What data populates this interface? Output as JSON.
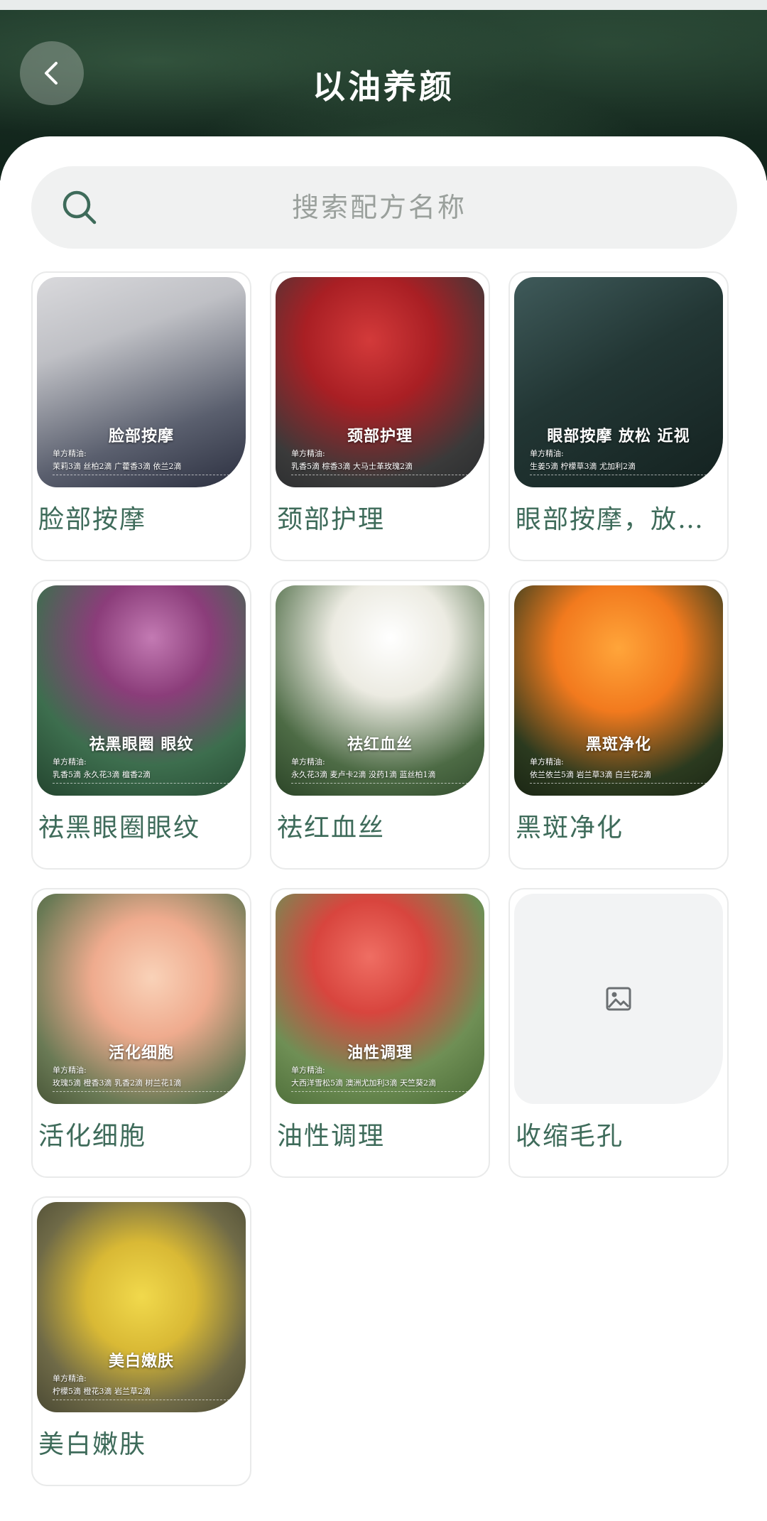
{
  "header": {
    "title": "以油养颜"
  },
  "search": {
    "placeholder": "搜索配方名称"
  },
  "cards": [
    {
      "label": "脸部按摩",
      "thumb_title": "脸部按摩",
      "thumb_sub": "单方精油:",
      "thumb_line": "茉莉3滴  丝柏2滴  广藿香3滴  依兰2滴",
      "bg": "linear-gradient(160deg,#d9d9dc 0%,#bfc0c5 30%,#5a5f6e 70%,#2c3040 100%)",
      "image": "white-peony"
    },
    {
      "label": "颈部护理",
      "thumb_title": "颈部护理",
      "thumb_sub": "单方精油:",
      "thumb_line": "乳香5滴  棕香3滴  大马士革玫瑰2滴",
      "bg": "radial-gradient(circle at 45% 30%,#d33a3a 0%,#a91f24 35%,#3a3a3a 75%,#2a2c2e 100%)",
      "image": "red-rose"
    },
    {
      "label": "眼部按摩，放松近视",
      "thumb_title": "眼部按摩 放松 近视",
      "thumb_sub": "单方精油:",
      "thumb_line": "生姜5滴  柠檬草3滴  尤加利2滴",
      "bg": "linear-gradient(150deg,#3f5a5a 0%,#223634 45%,#142220 100%)",
      "image": "dewy-leaves"
    },
    {
      "label": "祛黑眼圈眼纹",
      "thumb_title": "祛黑眼圈 眼纹",
      "thumb_sub": "单方精油:",
      "thumb_line": "乳香5滴  永久花3滴  檀香2滴",
      "bg": "radial-gradient(circle at 55% 25%,#c37ab3 0%,#8b3d7a 30%,#3d6e4e 65%,#24452f 100%)",
      "image": "purple-lotus"
    },
    {
      "label": "祛红血丝",
      "thumb_title": "祛红血丝",
      "thumb_sub": "单方精油:",
      "thumb_line": "永久花3滴  麦卢卡2滴  没药1滴  蓝丝柏1滴",
      "bg": "radial-gradient(circle at 55% 25%,#ffffff 0%,#ecebe2 30%,#4d6b45 70%,#2c4528 100%)",
      "image": "white-lotus"
    },
    {
      "label": "黑斑净化",
      "thumb_title": "黑斑净化",
      "thumb_sub": "单方精油:",
      "thumb_line": "依兰依兰5滴  岩兰草3滴  白兰花2滴",
      "bg": "radial-gradient(circle at 50% 30%,#ffa53a 0%,#f27a1e 35%,#2b3a1f 75%,#1b2614 100%)",
      "image": "orange-rose"
    },
    {
      "label": "活化细胞",
      "thumb_title": "活化细胞",
      "thumb_sub": "单方精油:",
      "thumb_line": "玫瑰5滴  橙香3滴  乳香2滴  树兰花1滴",
      "bg": "radial-gradient(circle at 55% 40%,#f9d2b8 0%,#efab8e 35%,#6a7a55 75%,#495638 100%)",
      "image": "peach-rose"
    },
    {
      "label": "油性调理",
      "thumb_title": "油性调理",
      "thumb_sub": "单方精油:",
      "thumb_line": "大西洋雪松5滴  澳洲尤加利3滴  天竺葵2滴",
      "bg": "radial-gradient(circle at 45% 30%,#ef6e63 0%,#d8453e 30%,#6f8f55 65%,#4a6a36 100%)",
      "image": "geranium"
    },
    {
      "label": "收缩毛孔",
      "image": "placeholder"
    },
    {
      "label": "美白嫩肤",
      "thumb_title": "美白嫩肤",
      "thumb_sub": "单方精油:",
      "thumb_line": "柠檬5滴  橙花3滴  岩兰草2滴",
      "bg": "radial-gradient(circle at 50% 45%,#f1d94c 0%,#d9b935 35%,#6f6a47 70%,#4b4a34 100%)",
      "image": "lemon"
    }
  ],
  "colors": {
    "accent": "#3e6b5a",
    "header_bg": "#1f3a2b",
    "search_bg": "#f0f1f1"
  }
}
